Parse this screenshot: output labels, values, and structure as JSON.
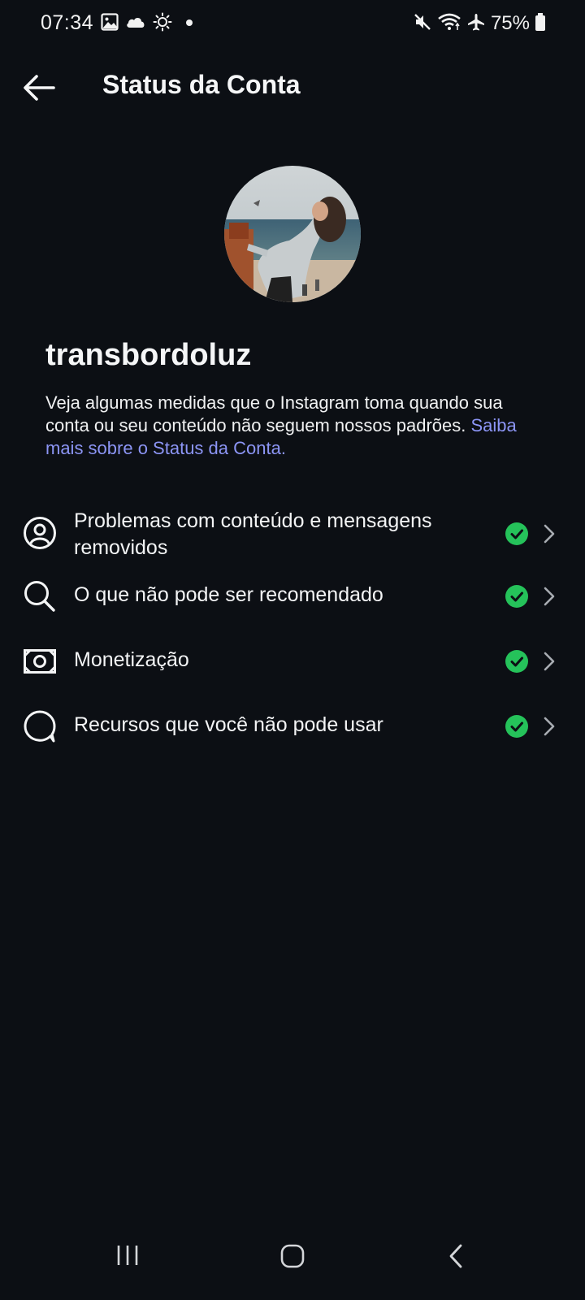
{
  "status_bar": {
    "time": "07:34",
    "battery": "75%",
    "left_icons": [
      "image-icon",
      "cloud-icon",
      "sun-icon",
      "dot-icon"
    ],
    "right_icons": [
      "mute-icon",
      "wifi-icon",
      "airplane-icon",
      "battery-icon"
    ]
  },
  "header": {
    "title": "Status da Conta",
    "back_icon": "back-arrow-icon"
  },
  "profile": {
    "username": "transbordoluz",
    "description": "Veja algumas medidas que o Instagram toma quando sua conta ou seu conteúdo não seguem nossos padrões.",
    "learn_more": "Saiba mais sobre o Status da Conta."
  },
  "items": [
    {
      "label": "Problemas com conteúdo e mensagens removidos",
      "icon": "user-circle-icon",
      "status": "ok"
    },
    {
      "label": "O que não pode ser recomendado",
      "icon": "search-icon",
      "status": "ok"
    },
    {
      "label": "Monetização",
      "icon": "money-icon",
      "status": "ok"
    },
    {
      "label": "Recursos que você não pode usar",
      "icon": "chat-bubble-icon",
      "status": "ok"
    }
  ],
  "colors": {
    "background": "#0c0f14",
    "link": "#8c95f5",
    "check": "#25c25a"
  },
  "nav_bar": {
    "icons": [
      "recent-apps-icon",
      "home-icon",
      "back-icon"
    ]
  }
}
